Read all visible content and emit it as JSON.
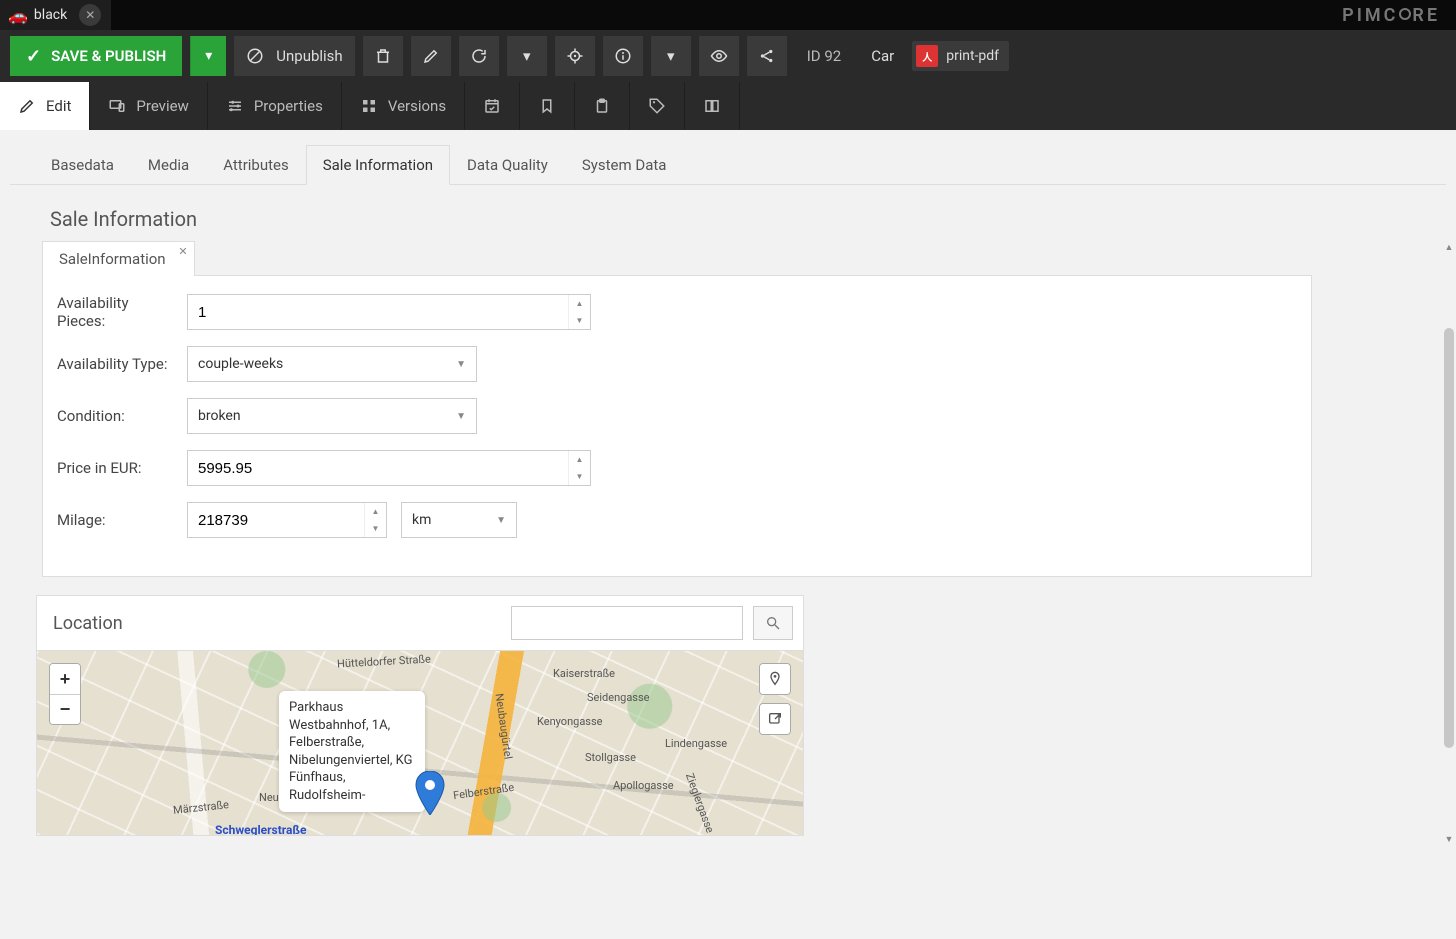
{
  "window": {
    "file_tab": "black",
    "brand": "PIMCORE"
  },
  "toolbar": {
    "save_label": "SAVE & PUBLISH",
    "unpublish_label": "Unpublish",
    "id_label": "ID 92",
    "class_label": "Car",
    "pdf_label": "print-pdf"
  },
  "view_tabs": {
    "edit": "Edit",
    "preview": "Preview",
    "properties": "Properties",
    "versions": "Versions"
  },
  "data_tabs": {
    "items": [
      {
        "label": "Basedata",
        "active": false
      },
      {
        "label": "Media",
        "active": false
      },
      {
        "label": "Attributes",
        "active": false
      },
      {
        "label": "Sale Information",
        "active": true
      },
      {
        "label": "Data Quality",
        "active": false
      },
      {
        "label": "System Data",
        "active": false
      }
    ]
  },
  "section": {
    "heading": "Sale Information",
    "inner_tab": "SaleInformation"
  },
  "form": {
    "availability_pieces": {
      "label": "Availability Pieces:",
      "value": "1"
    },
    "availability_type": {
      "label": "Availability Type:",
      "value": "couple-weeks"
    },
    "condition": {
      "label": "Condition:",
      "value": "broken"
    },
    "price_eur": {
      "label": "Price in EUR:",
      "value": "5995.95"
    },
    "milage": {
      "label": "Milage:",
      "value": "218739",
      "unit": "km"
    }
  },
  "location": {
    "heading": "Location",
    "search_value": "",
    "popup_text": "Parkhaus Westbahnhof, 1A, Felberstraße, Nibelungenviertel, KG Fünfhaus, Rudolfsheim-",
    "map_labels": {
      "hutteldorfer": "Hütteldorfer Straße",
      "marzstrasse": "Märzstraße",
      "schwegler": "Schweglerstraße",
      "felber": "Felberstraße",
      "neubaugurtel": "Neubaugürtel",
      "stollgasse": "Stollgasse",
      "apollogasse": "Apollogasse",
      "seidengasse": "Seidengasse",
      "kaiserstrasse": "Kaiserstraße",
      "lindengasse": "Lindengasse",
      "kenyongasse": "Kenyongasse",
      "neufun": "Neu-Fün",
      "zieglergasse": "Zieglergasse"
    }
  },
  "colors": {
    "primary_green": "#2aa438",
    "toolbar_bg": "#2a2a2a",
    "page_bg": "#f2f2f2"
  }
}
